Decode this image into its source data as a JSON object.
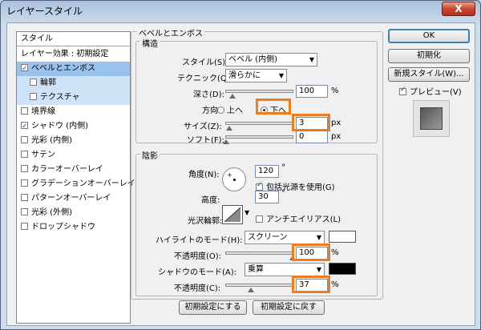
{
  "window": {
    "title": "レイヤースタイル",
    "close": "X"
  },
  "style_list": {
    "header": "スタイル",
    "items": [
      {
        "label": "レイヤー効果 : 初期設定",
        "checkbox": false,
        "checked": false
      },
      {
        "label": "ベベルとエンボス",
        "checkbox": true,
        "checked": true
      },
      {
        "label": "輪郭",
        "checkbox": true,
        "checked": false
      },
      {
        "label": "テクスチャ",
        "checkbox": true,
        "checked": false
      },
      {
        "label": "境界線",
        "checkbox": true,
        "checked": false
      },
      {
        "label": "シャドウ (内側)",
        "checkbox": true,
        "checked": true
      },
      {
        "label": "光彩 (内側)",
        "checkbox": true,
        "checked": false
      },
      {
        "label": "サテン",
        "checkbox": true,
        "checked": false
      },
      {
        "label": "カラーオーバーレイ",
        "checkbox": true,
        "checked": false
      },
      {
        "label": "グラデーションオーバーレイ",
        "checkbox": true,
        "checked": false
      },
      {
        "label": "パターンオーバーレイ",
        "checkbox": true,
        "checked": false
      },
      {
        "label": "光彩 (外側)",
        "checkbox": true,
        "checked": false
      },
      {
        "label": "ドロップシャドウ",
        "checkbox": true,
        "checked": false
      }
    ]
  },
  "bevel": {
    "group_title": "ベベルとエンボス",
    "structure_title": "構造",
    "style_label": "スタイル(S):",
    "style_value": "ベベル (内側)",
    "technique_label": "テクニック(Q):",
    "technique_value": "滑らかに",
    "depth_label": "深さ(D):",
    "depth_value": "100",
    "depth_unit": "%",
    "direction_label": "方向:",
    "direction_up": "上へ",
    "direction_down": "下へ",
    "size_label": "サイズ(Z):",
    "size_value": "3",
    "size_unit": "px",
    "soften_label": "ソフト(F):",
    "soften_value": "0",
    "soften_unit": "px"
  },
  "shading": {
    "title": "陰影",
    "angle_label": "角度(N):",
    "angle_value": "120",
    "angle_unit": "°",
    "global_light_label": "包括光源を使用(G)",
    "altitude_label": "高度:",
    "altitude_value": "30",
    "altitude_unit": "°",
    "gloss_label": "光沢輪郭:",
    "antialias_label": "アンチエイリアス(L)",
    "highlight_mode_label": "ハイライトのモード(H):",
    "highlight_mode_value": "スクリーン",
    "highlight_color": "#ffffff",
    "highlight_opacity_label": "不透明度(O):",
    "highlight_opacity_value": "100",
    "highlight_opacity_unit": "%",
    "shadow_mode_label": "シャドウのモード(A):",
    "shadow_mode_value": "乗算",
    "shadow_color": "#000000",
    "shadow_opacity_label": "不透明度(C):",
    "shadow_opacity_value": "37",
    "shadow_opacity_unit": "%"
  },
  "buttons": {
    "reset_default": "初期設定にする",
    "restore_default": "初期設定に戻す",
    "ok": "OK",
    "reset": "初期化",
    "new_style": "新規スタイル(W)...",
    "preview": "プレビュー(V)"
  },
  "levels": {
    "depth": 0.1,
    "size": 0.05,
    "soften": 0.0,
    "highlight_opacity": 1.0,
    "shadow_opacity": 0.37
  },
  "colors": {
    "highlight_box": "#f07c1b",
    "selection": "#99c3ee"
  }
}
